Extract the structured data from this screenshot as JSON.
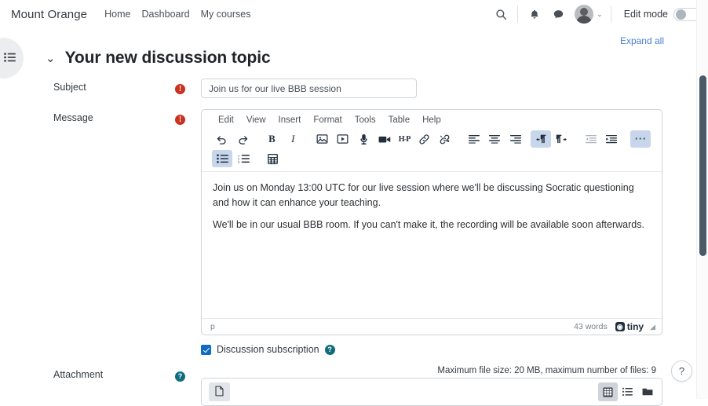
{
  "navbar": {
    "brand": "Mount Orange",
    "links": [
      {
        "label": "Home",
        "name": "nav-link-home"
      },
      {
        "label": "Dashboard",
        "name": "nav-link-dashboard"
      },
      {
        "label": "My courses",
        "name": "nav-link-my-courses"
      }
    ],
    "search_icon": "search-icon",
    "notifications_icon": "bell-icon",
    "messages_icon": "message-icon",
    "avatar_caret": "⌄",
    "edit_mode_label": "Edit mode",
    "edit_mode_on": false
  },
  "page": {
    "expand_all": "Expand all",
    "title": "Your new discussion topic",
    "collapse_chevron": "⌄",
    "drawer_icon": "course-index-icon"
  },
  "form": {
    "subject": {
      "label": "Subject",
      "required_marker": "!",
      "value": "Join us for our live BBB session",
      "placeholder": ""
    },
    "message": {
      "label": "Message",
      "required_marker": "!"
    },
    "attachment": {
      "label": "Attachment",
      "help_marker": "?",
      "note": "Maximum file size: 20 MB, maximum number of files: 9"
    },
    "subscription": {
      "label": "Discussion subscription",
      "checked": true,
      "help_marker": "?"
    }
  },
  "editor": {
    "menu": [
      {
        "label": "Edit",
        "name": "menu-edit"
      },
      {
        "label": "View",
        "name": "menu-view"
      },
      {
        "label": "Insert",
        "name": "menu-insert"
      },
      {
        "label": "Format",
        "name": "menu-format"
      },
      {
        "label": "Tools",
        "name": "menu-tools"
      },
      {
        "label": "Table",
        "name": "menu-table"
      },
      {
        "label": "Help",
        "name": "menu-help"
      }
    ],
    "toolbar_row1": [
      "undo-icon",
      "redo-icon",
      "bold-icon",
      "italic-icon",
      "image-icon",
      "media-icon",
      "microphone-icon",
      "video-camera-icon",
      "h5p-icon",
      "link-icon",
      "unlink-icon",
      "align-left-icon",
      "align-center-icon",
      "align-right-icon",
      "ltr-direction-icon",
      "rtl-direction-icon",
      "outdent-icon",
      "indent-icon",
      "more-options-icon"
    ],
    "toolbar_row2": [
      "bullet-list-icon",
      "numbered-list-icon",
      "equation-icon"
    ],
    "body_paragraphs": [
      "Join us on Monday 13:00 UTC for our live session where we'll be discussing Socratic questioning and how it can enhance your teaching.",
      "We'll be in our usual BBB room. If you can't make it, the recording will be available soon afterwards."
    ],
    "status": {
      "element_path": "p",
      "word_count": "43 words",
      "brand": "tiny",
      "brand_mark": "◉"
    }
  },
  "filemanager": {
    "add_file_icon": "file-icon",
    "views": [
      {
        "name": "view-grid-icon",
        "active": true
      },
      {
        "name": "view-list-icon",
        "active": false
      },
      {
        "name": "view-tree-icon",
        "active": false
      }
    ]
  },
  "help_fab": {
    "label": "?"
  },
  "colors": {
    "accent_blue": "#0f6cbf",
    "required_red": "#ca3120",
    "help_teal": "#0f6d7d",
    "link_blue": "#4a7fd0",
    "tb_active": "#c8d6ec"
  }
}
